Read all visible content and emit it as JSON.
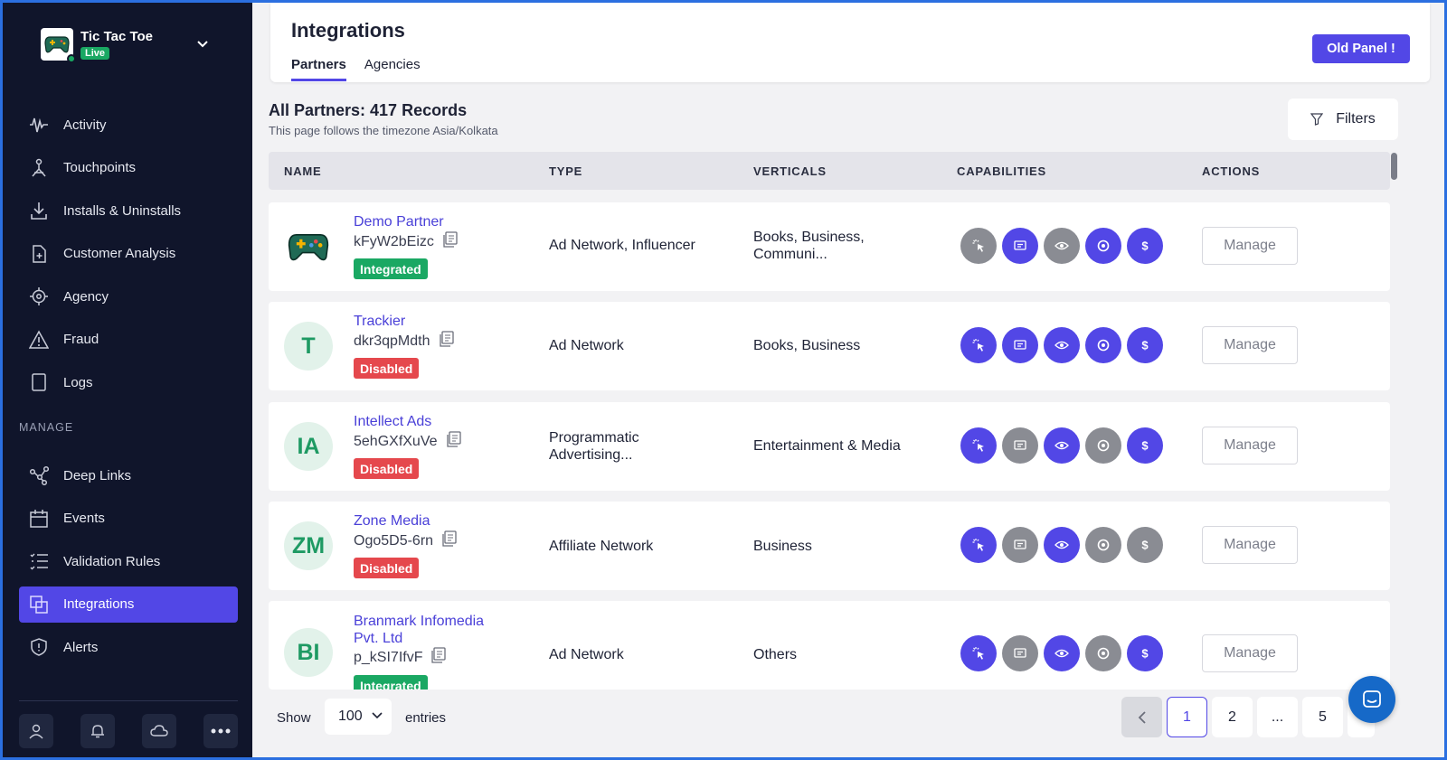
{
  "app": {
    "name": "Tic Tac Toe",
    "status": "Live"
  },
  "sidebar": {
    "items": [
      {
        "label": "Activity",
        "icon": "activity-icon"
      },
      {
        "label": "Touchpoints",
        "icon": "touchpoints-icon"
      },
      {
        "label": "Installs & Uninstalls",
        "icon": "download-icon"
      },
      {
        "label": "Customer Analysis",
        "icon": "document-plus-icon"
      },
      {
        "label": "Agency",
        "icon": "agency-icon"
      },
      {
        "label": "Fraud",
        "icon": "warning-icon"
      },
      {
        "label": "Logs",
        "icon": "logs-icon"
      }
    ],
    "manage_heading": "MANAGE",
    "manage_items": [
      {
        "label": "Deep Links",
        "icon": "share-icon"
      },
      {
        "label": "Events",
        "icon": "calendar-icon"
      },
      {
        "label": "Validation Rules",
        "icon": "list-icon"
      },
      {
        "label": "Integrations",
        "icon": "integrations-icon",
        "active": true
      },
      {
        "label": "Alerts",
        "icon": "shield-icon"
      }
    ],
    "bottom_icons": [
      "user-icon",
      "bell-icon",
      "cloud-icon",
      "more-icon"
    ]
  },
  "header": {
    "title": "Integrations",
    "tabs": [
      "Partners",
      "Agencies"
    ],
    "active_tab": "Partners",
    "old_panel_label": "Old Panel !"
  },
  "records": {
    "title": "All Partners: 417 Records",
    "subtitle": "This page follows the timezone Asia/Kolkata",
    "filters_label": "Filters"
  },
  "table": {
    "columns": [
      "NAME",
      "TYPE",
      "VERTICALS",
      "CAPABILITIES",
      "ACTIONS"
    ],
    "manage_label": "Manage",
    "capability_icons": [
      "click-icon",
      "message-icon",
      "eye-icon",
      "target-icon",
      "dollar-icon"
    ],
    "rows": [
      {
        "avatar": "",
        "logo": "gamepad",
        "name": "Demo Partner",
        "id": "kFyW2bEizc",
        "status": "Integrated",
        "type": "Ad Network, Influencer",
        "verticals": "Books, Business, Communi...",
        "caps": [
          false,
          true,
          false,
          true,
          true
        ]
      },
      {
        "avatar": "T",
        "name": "Trackier",
        "id": "dkr3qpMdth",
        "status": "Disabled",
        "type": "Ad Network",
        "verticals": "Books, Business",
        "caps": [
          true,
          true,
          true,
          true,
          true
        ]
      },
      {
        "avatar": "IA",
        "name": "Intellect Ads",
        "id": "5ehGXfXuVe",
        "status": "Disabled",
        "type": "Programmatic Advertising...",
        "verticals": "Entertainment & Media",
        "caps": [
          true,
          false,
          true,
          false,
          true
        ]
      },
      {
        "avatar": "ZM",
        "name": "Zone Media",
        "id": "Ogo5D5-6rn",
        "status": "Disabled",
        "type": "Affiliate Network",
        "verticals": "Business",
        "caps": [
          true,
          false,
          true,
          false,
          false
        ]
      },
      {
        "avatar": "BI",
        "name": "Branmark Infomedia Pvt. Ltd",
        "id": "p_kSI7IfvF",
        "status": "Integrated",
        "type": "Ad Network",
        "verticals": "Others",
        "caps": [
          true,
          false,
          true,
          false,
          true
        ]
      }
    ]
  },
  "footer": {
    "show_label": "Show",
    "entries_value": "100",
    "entries_label": "entries",
    "pages": [
      "1",
      "2",
      "...",
      "5"
    ],
    "current_page": "1"
  },
  "colors": {
    "accent": "#5247e6",
    "sidebar_bg": "#10152b",
    "success": "#1aa863",
    "danger": "#e5484d",
    "cap_off": "#8a8c93"
  }
}
